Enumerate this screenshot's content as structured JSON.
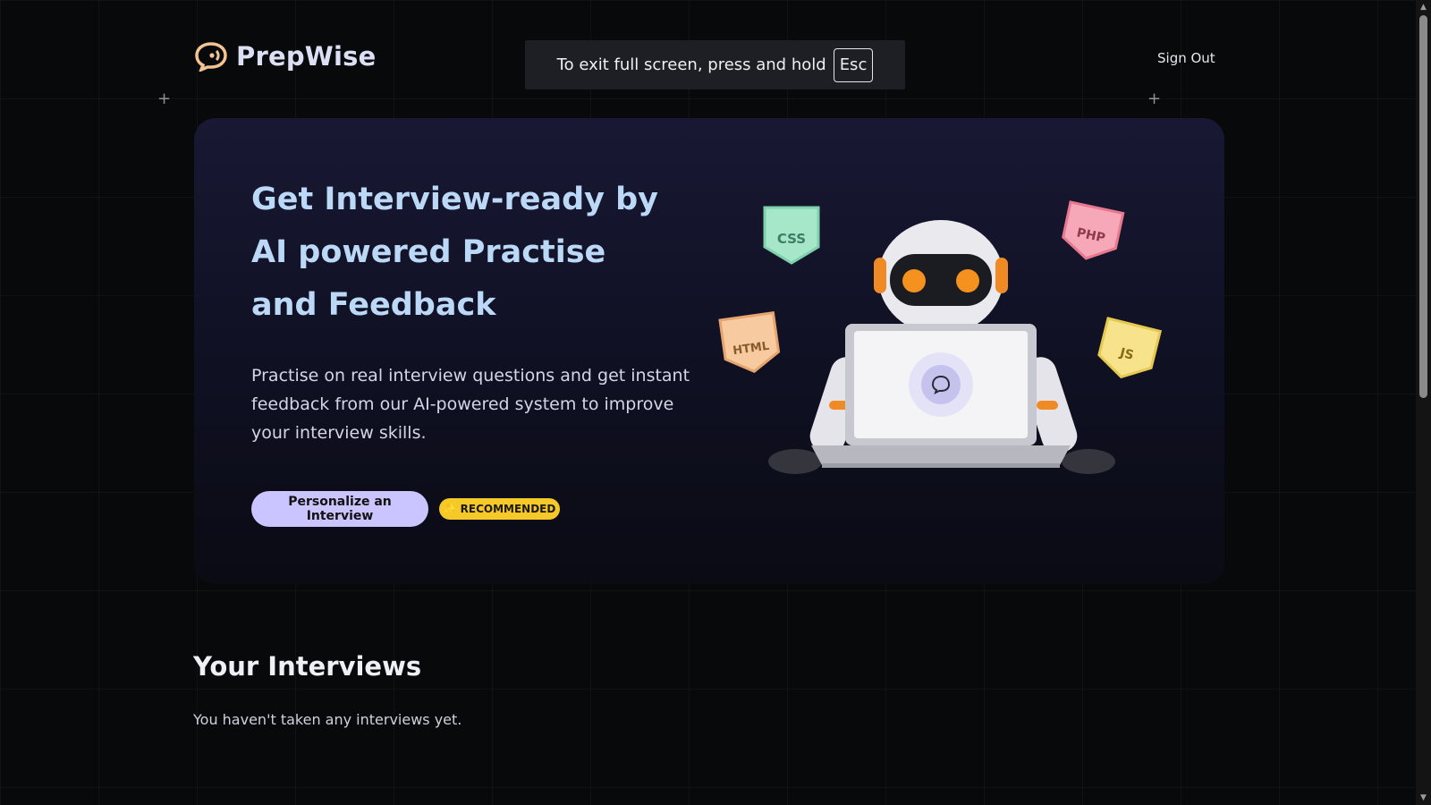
{
  "header": {
    "brand": "PrepWise",
    "sign_out": "Sign Out"
  },
  "fullscreen_notice": {
    "text": "To exit full screen, press and hold",
    "key": "Esc"
  },
  "hero": {
    "title": "Get Interview-ready by AI powered Practise and Feedback",
    "description": "Practise on real interview questions and get instant feedback from our AI-powered system to improve your interview skills.",
    "cta_label": "Personalize an Interview",
    "badge_label": "RECOMMENDED",
    "illustration_tags": [
      "CSS",
      "PHP",
      "HTML",
      "JS"
    ]
  },
  "interviews": {
    "title": "Your Interviews",
    "empty_message": "You haven't taken any interviews yet."
  },
  "colors": {
    "background": "#08090b",
    "title": "#bcd8f7",
    "cta": "#cac5fe",
    "badge": "#f7c928"
  }
}
